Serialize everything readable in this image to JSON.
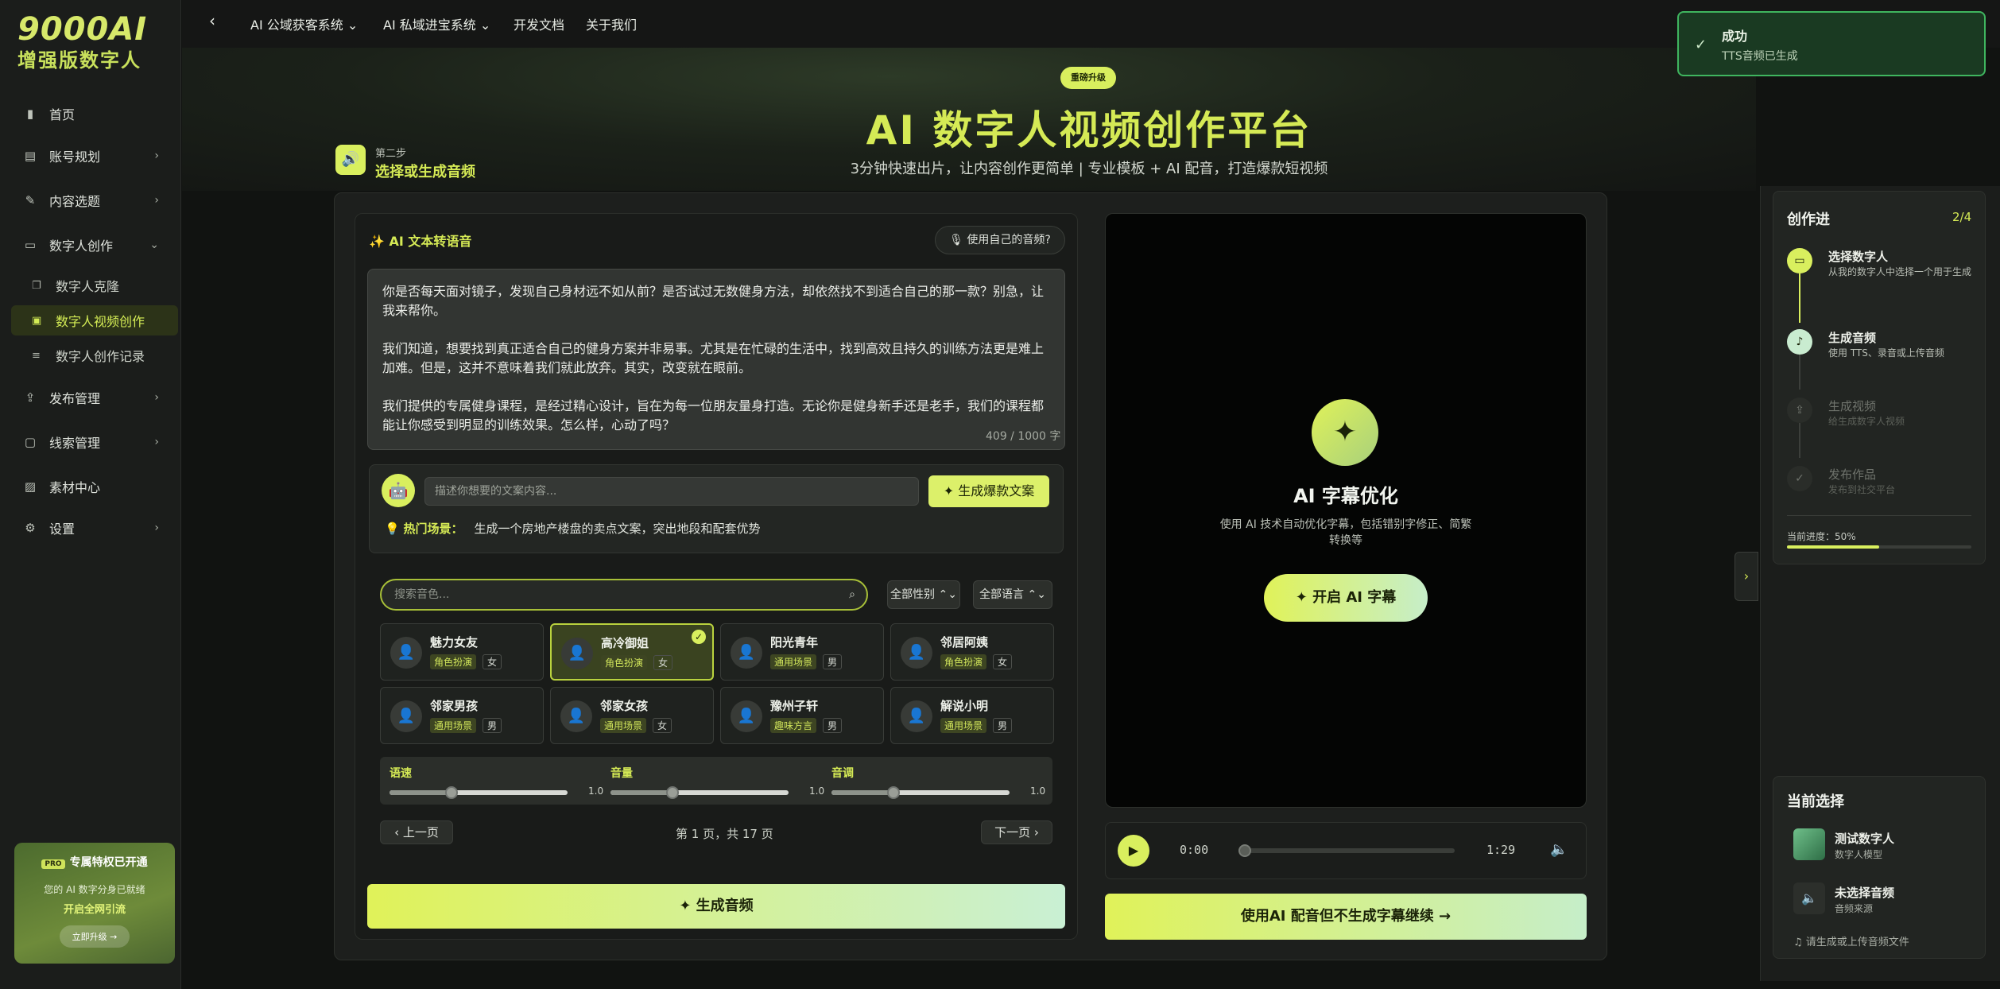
{
  "logo": {
    "line1": "9000AI",
    "line2": "增强版数字人"
  },
  "sidebar": {
    "items": [
      {
        "label": "首页",
        "icon": "bar-chart-icon"
      },
      {
        "label": "账号规划",
        "icon": "clipboard-icon"
      },
      {
        "label": "内容选题",
        "icon": "wand-icon"
      },
      {
        "label": "数字人创作",
        "icon": "video-icon"
      },
      {
        "label": "发布管理",
        "icon": "upload-icon"
      },
      {
        "label": "线索管理",
        "icon": "chat-icon"
      },
      {
        "label": "素材中心",
        "icon": "image-icon"
      },
      {
        "label": "设置",
        "icon": "gear-icon"
      }
    ],
    "subitems": [
      {
        "label": "数字人克隆"
      },
      {
        "label": "数字人视频创作"
      },
      {
        "label": "数字人创作记录"
      }
    ],
    "promo": {
      "badge": "PRO",
      "title": "专属特权已开通",
      "desc": "您的 AI 数字分身已就绪",
      "highlight": "开启全网引流",
      "button": "立即升级 →"
    }
  },
  "topnav": {
    "items": [
      "AI 公域获客系统 ⌄",
      "AI 私域进宝系统 ⌄",
      "开发文档",
      "关于我们"
    ]
  },
  "hero": {
    "badge": "重磅升级",
    "title": "AI 数字人视频创作平台",
    "subtitle": "3分钟快速出片，让内容创作更简单 | 专业模板 + AI 配音，打造爆款短视频"
  },
  "step": {
    "number": "第二步",
    "title": "选择或生成音频"
  },
  "tts": {
    "title": "AI 文本转语音",
    "own_audio": "使用自己的音频?",
    "text": "你是否每天面对镜子，发现自己身材远不如从前？是否试过无数健身方法，却依然找不到适合自己的那一款？别急，让我来帮你。\n\n我们知道，想要找到真正适合自己的健身方案并非易事。尤其是在忙碌的生活中，找到高效且持久的训练方法更是难上加难。但是，这并不意味着我们就此放弃。其实，改变就在眼前。\n\n我们提供的专属健身课程，是经过精心设计，旨在为每一位朋友量身打造。无论你是健身新手还是老手，我们的课程都能让你感受到明显的训练效果。怎么样，心动了吗？",
    "count": "409 / 1000 字",
    "gen_placeholder": "描述你想要的文案内容...",
    "gen_button": "生成爆款文案",
    "hot_label": "热门场景：",
    "hot_text": "生成一个房地产楼盘的卖点文案，突出地段和配套优势",
    "search_placeholder": "搜索音色...",
    "filter_gender": "全部性别 ⌃⌄",
    "filter_lang": "全部语言 ⌃⌄",
    "voices": [
      {
        "name": "魅力女友",
        "tag": "角色扮演",
        "gender": "女",
        "selected": false
      },
      {
        "name": "高冷御姐",
        "tag": "角色扮演",
        "gender": "女",
        "selected": true
      },
      {
        "name": "阳光青年",
        "tag": "通用场景",
        "gender": "男",
        "selected": false
      },
      {
        "name": "邻居阿姨",
        "tag": "角色扮演",
        "gender": "女",
        "selected": false
      },
      {
        "name": "邻家男孩",
        "tag": "通用场景",
        "gender": "男",
        "selected": false
      },
      {
        "name": "邻家女孩",
        "tag": "通用场景",
        "gender": "女",
        "selected": false
      },
      {
        "name": "豫州子轩",
        "tag": "趣味方言",
        "gender": "男",
        "selected": false
      },
      {
        "name": "解说小明",
        "tag": "通用场景",
        "gender": "男",
        "selected": false
      }
    ],
    "sliders": [
      {
        "label": "语速",
        "value": "1.0",
        "level": 0.35
      },
      {
        "label": "音量",
        "value": "1.0",
        "level": 0.35
      },
      {
        "label": "音调",
        "value": "1.0",
        "level": 0.35
      }
    ],
    "prev": "上一页",
    "next": "下一页",
    "page_info": "第 1 页，共 17 页",
    "generate": "生成音频"
  },
  "preview": {
    "ai_title": "AI 字幕优化",
    "ai_desc": "使用 AI 技术自动优化字幕，包括错别字修正、简繁转换等",
    "ai_button": "开启 AI 字幕",
    "time_current": "0:00",
    "time_total": "1:29",
    "continue": "使用AI 配音但不生成字幕继续"
  },
  "progress": {
    "title": "创作进",
    "count": "2/4",
    "steps": [
      {
        "name": "选择数字人",
        "desc": "从我的数字人中选择一个用于生成",
        "state": "done"
      },
      {
        "name": "生成音频",
        "desc": "使用 TTS、录音或上传音频",
        "state": "active"
      },
      {
        "name": "生成视频",
        "desc": "给生成数字人视频",
        "state": "pending"
      },
      {
        "name": "发布作品",
        "desc": "发布到社交平台",
        "state": "pending"
      }
    ],
    "current": "当前进度：50%",
    "percent": 0.5
  },
  "selection": {
    "title": "当前选择",
    "items": [
      {
        "name": "测试数字人",
        "desc": "数字人模型"
      },
      {
        "name": "未选择音频",
        "desc": "音频来源"
      }
    ],
    "hint": "请生成或上传音频文件"
  },
  "toast": {
    "title": "成功",
    "desc": "TTS音频已生成"
  },
  "colors": {
    "accent": "#d9ef5e",
    "bg": "#111311",
    "success": "#3fb55f"
  }
}
